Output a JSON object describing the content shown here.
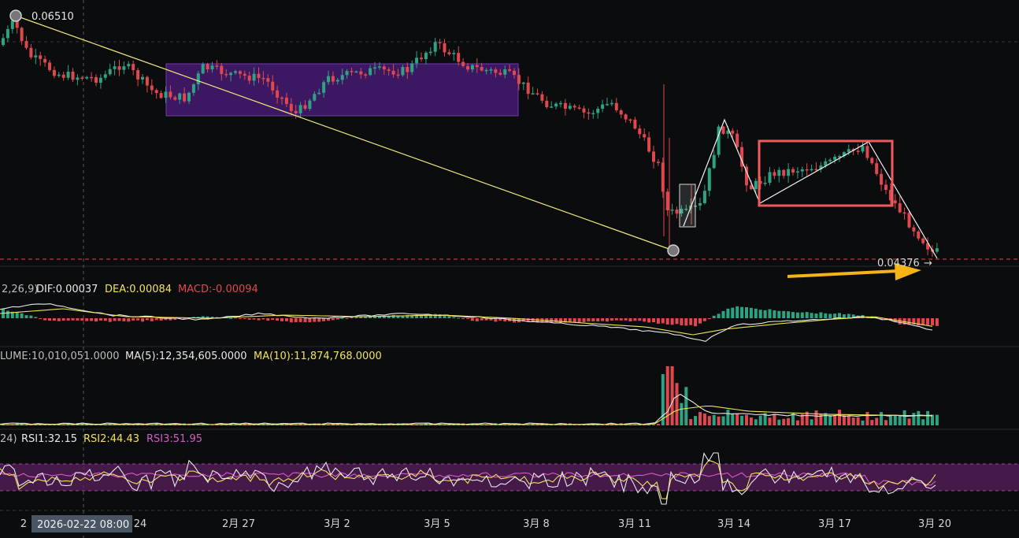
{
  "colors": {
    "background": "#0b0c0e",
    "up": "#2ea383",
    "down": "#e0484e",
    "macd_up": "#2ea383",
    "macd_down": "#e0484e",
    "dif": "#e8e8e8",
    "dea": "#f1e25b",
    "macd_label": "#e0484e",
    "ma5": "#e8e8e8",
    "ma10": "#f1e25b",
    "rsi1": "#e8e8e8",
    "rsi2": "#f1e25b",
    "rsi3": "#d65ac8",
    "trend_line": "#efe87a",
    "range_box": "#6f2ea6",
    "pattern_box": "#ef5a5a",
    "arrow": "#f5b316",
    "grid_dash": "#3a3a3a",
    "price_dash": "#e0484e"
  },
  "price_panel": {
    "high_label": "0.06510",
    "last_label": "0.04376"
  },
  "macd_panel": {
    "params": "2,26,9)",
    "dif_label": "DIF:0.00037",
    "dea_label": "DEA:0.00084",
    "macd_label": "MACD:-0.00094"
  },
  "volume_panel": {
    "volume_label": "LUME:10,010,051.0000",
    "ma5_label": "MA(5):12,354,605.0000",
    "ma10_label": "MA(10):11,874,768.0000"
  },
  "rsi_panel": {
    "params": "24)",
    "rsi1_label": "RSI1:32.15",
    "rsi2_label": "RSI2:44.43",
    "rsi3_label": "RSI3:51.95"
  },
  "crosshair_label": "2026-02-22 08:00",
  "chart_data": {
    "type": "candlestick",
    "x_ticks": [
      "2",
      "24",
      "2月 27",
      "3月 2",
      "3月 5",
      "3月 8",
      "3月 11",
      "3月 14",
      "3月 17",
      "3月 20"
    ],
    "price_annotations": {
      "high": 0.0651,
      "last": 0.04376
    },
    "indicators": {
      "macd": {
        "dif": 0.00037,
        "dea": 0.00084,
        "macd": -0.00094
      },
      "volume": {
        "volume": 10010051,
        "ma5": 12354605,
        "ma10": 11874768
      },
      "rsi": {
        "rsi1": 32.15,
        "rsi2": 44.43,
        "rsi3": 51.95
      }
    },
    "grid": true
  }
}
